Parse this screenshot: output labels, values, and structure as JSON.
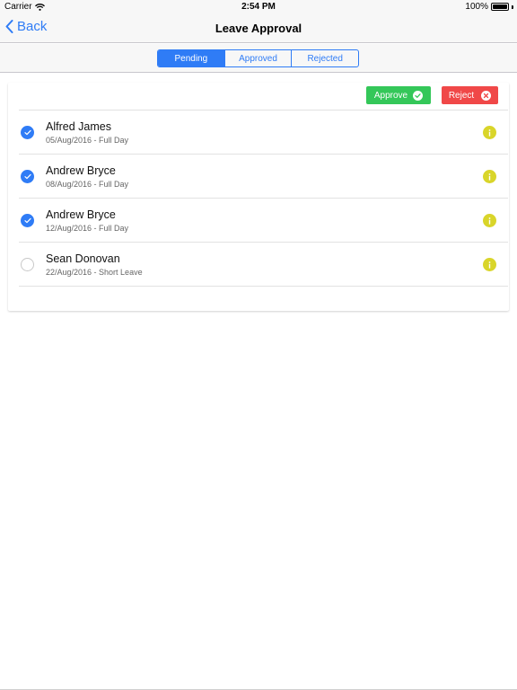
{
  "status_bar": {
    "carrier": "Carrier",
    "time": "2:54 PM",
    "battery": "100%"
  },
  "nav": {
    "back_label": "Back",
    "title": "Leave Approval"
  },
  "segments": [
    {
      "label": "Pending",
      "active": true
    },
    {
      "label": "Approved",
      "active": false
    },
    {
      "label": "Rejected",
      "active": false
    }
  ],
  "actions": {
    "approve_label": "Approve",
    "reject_label": "Reject"
  },
  "requests": [
    {
      "name": "Alfred James",
      "detail": "05/Aug/2016 - Full Day",
      "selected": true
    },
    {
      "name": "Andrew Bryce",
      "detail": "08/Aug/2016 - Full Day",
      "selected": true
    },
    {
      "name": "Andrew Bryce",
      "detail": "12/Aug/2016 - Full Day",
      "selected": true
    },
    {
      "name": "Sean Donovan",
      "detail": "22/Aug/2016 - Short Leave",
      "selected": false
    }
  ],
  "colors": {
    "accent": "#2f7cf6",
    "approve": "#34c759",
    "reject": "#f04848",
    "info": "#d9d52a"
  }
}
